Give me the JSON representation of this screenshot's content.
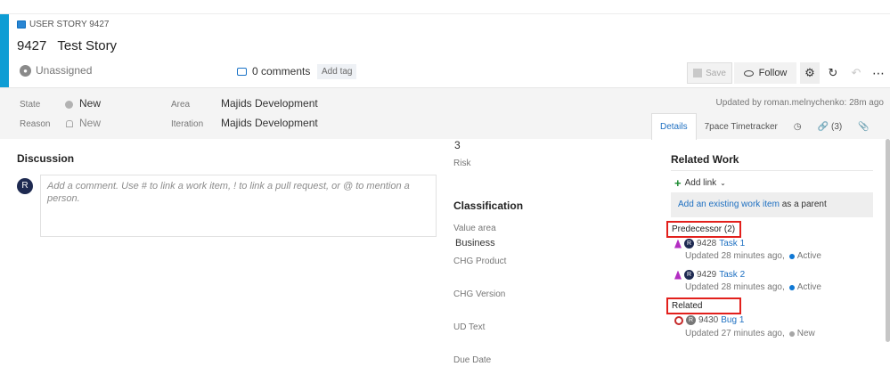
{
  "header": {
    "type_label": "USER STORY 9427",
    "id": "9427",
    "title": "Test Story",
    "assignee": "Unassigned",
    "comments": "0 comments",
    "add_tag": "Add tag",
    "save": "Save",
    "follow": "Follow",
    "accent_color": "#0e9dd4"
  },
  "meta": {
    "state_label": "State",
    "state_value": "New",
    "reason_label": "Reason",
    "reason_value": "New",
    "area_label": "Area",
    "area_value": "Majids Development",
    "iteration_label": "Iteration",
    "iteration_value": "Majids Development",
    "updated_by": "Updated by roman.melnychenko: 28m ago",
    "tabs": [
      {
        "label": "Details",
        "active": true
      },
      {
        "label": "7pace Timetracker"
      },
      {
        "label": "history-icon"
      },
      {
        "label": "(3)"
      },
      {
        "label": "attachment-icon"
      }
    ]
  },
  "discussion": {
    "title": "Discussion",
    "avatar_initial": "R",
    "placeholder": "Add a comment. Use # to link a work item, ! to link a pull request, or @ to mention a person."
  },
  "fields": {
    "risk_value": "3",
    "risk_label": "Risk",
    "classification_title": "Classification",
    "value_area_label": "Value area",
    "value_area_value": "Business",
    "chg_product_label": "CHG Product",
    "chg_version_label": "CHG Version",
    "ud_text_label": "UD Text",
    "due_date_label": "Due Date"
  },
  "related_work": {
    "title": "Related Work",
    "add_link": "Add link",
    "existing_link": "Add an existing work item",
    "existing_suffix": "as a parent",
    "groups": [
      {
        "label": "Predecessor (2)",
        "items": [
          {
            "id": "9428",
            "title": "Task 1",
            "updated": "Updated 28 minutes ago,",
            "status": "Active",
            "avatar": "R"
          },
          {
            "id": "9429",
            "title": "Task 2",
            "updated": "Updated 28 minutes ago,",
            "status": "Active",
            "avatar": "R"
          }
        ]
      },
      {
        "label": "Related",
        "items": [
          {
            "id": "9430",
            "title": "Bug 1",
            "updated": "Updated 27 minutes ago,",
            "status": "New",
            "avatar": "R"
          }
        ]
      }
    ]
  }
}
